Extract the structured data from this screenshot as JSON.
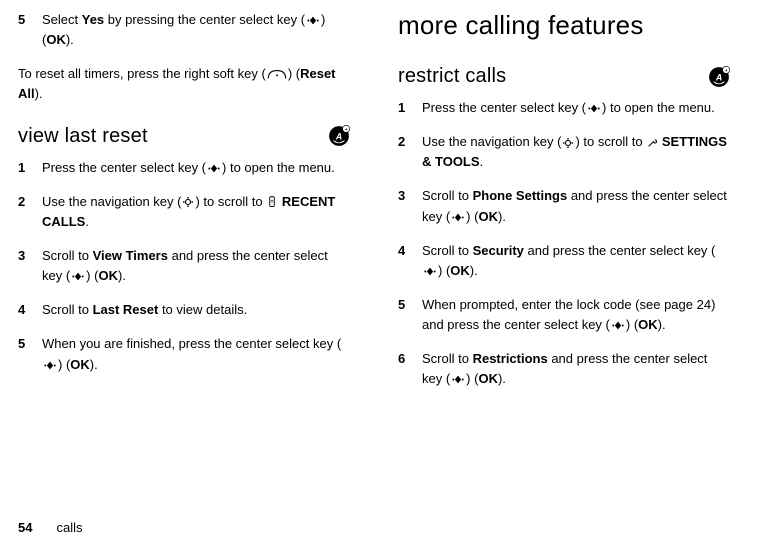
{
  "left": {
    "step5": {
      "num": "5",
      "t1": "Select ",
      "b1": "Yes",
      "t2": " by pressing the center select key (",
      "t3": ") (",
      "b2": "OK",
      "t4": ")."
    },
    "reset": {
      "t1": "To reset all timers, press the right soft key (",
      "t2": ") (",
      "b1": "Reset All",
      "t3": ")."
    },
    "heading": "view last reset",
    "s1": {
      "num": "1",
      "t1": "Press the center select key (",
      "t2": ") to open the menu."
    },
    "s2": {
      "num": "2",
      "t1": "Use the navigation key (",
      "t2": ") to scroll to ",
      "b1": "RECENT CALLS",
      "t3": "."
    },
    "s3": {
      "num": "3",
      "t1": "Scroll to ",
      "b1": "View Timers",
      "t2": " and press the center select key (",
      "t3": ") (",
      "b2": "OK",
      "t4": ")."
    },
    "s4": {
      "num": "4",
      "t1": "Scroll to ",
      "b1": "Last Reset",
      "t2": " to view details."
    },
    "s5": {
      "num": "5",
      "t1": "When you are finished, press the center select key (",
      "t2": ") (",
      "b1": "OK",
      "t3": ")."
    }
  },
  "right": {
    "main_heading": "more calling features",
    "sub_heading": "restrict calls",
    "s1": {
      "num": "1",
      "t1": "Press the center select key (",
      "t2": ") to open the menu."
    },
    "s2": {
      "num": "2",
      "t1": "Use the navigation key (",
      "t2": ") to scroll to ",
      "b1": "SETTINGS & TOOLS",
      "t3": "."
    },
    "s3": {
      "num": "3",
      "t1": "Scroll to ",
      "b1": "Phone Settings",
      "t2": " and press the center select key (",
      "t3": ") (",
      "b2": "OK",
      "t4": ")."
    },
    "s4": {
      "num": "4",
      "t1": "Scroll to ",
      "b1": "Security",
      "t2": " and press the center select key (",
      "t3": ") (",
      "b2": "OK",
      "t4": ")."
    },
    "s5": {
      "num": "5",
      "t1": "When prompted, enter the lock code (see page 24) and press the center select key (",
      "t2": ") (",
      "b1": "OK",
      "t3": ")."
    },
    "s6": {
      "num": "6",
      "t1": "Scroll to ",
      "b1": "Restrictions",
      "t2": " and press the center select key (",
      "t3": ") (",
      "b2": "OK",
      "t4": ")."
    }
  },
  "footer": {
    "page": "54",
    "label": "calls"
  }
}
